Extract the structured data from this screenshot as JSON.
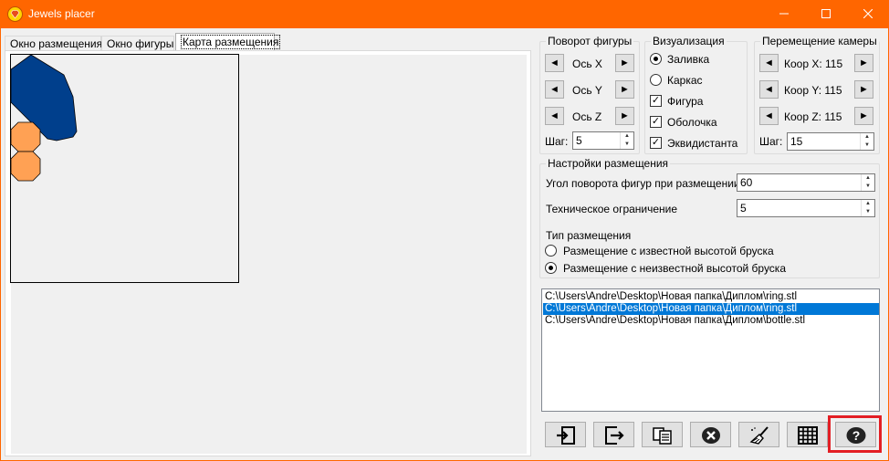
{
  "window": {
    "title": "Jewels placer",
    "accent": "#ff6600",
    "controls": {
      "minimize": "minimize-icon",
      "maximize": "maximize-icon",
      "close": "close-icon"
    }
  },
  "tabs": [
    {
      "label": "Окно размещения"
    },
    {
      "label": "Окно фигуры"
    },
    {
      "label": "Карта размещения",
      "active": true
    }
  ],
  "rotation": {
    "title": "Поворот фигуры",
    "axes": [
      "Ось X",
      "Ось Y",
      "Ось Z"
    ],
    "step_label": "Шаг:",
    "step_value": "5"
  },
  "visualization": {
    "title": "Визуализация",
    "radios": [
      {
        "label": "Заливка",
        "checked": true
      },
      {
        "label": "Каркас",
        "checked": false
      }
    ],
    "checks": [
      {
        "label": "Фигура",
        "checked": true
      },
      {
        "label": "Оболочка",
        "checked": true
      },
      {
        "label": "Эквидистанта",
        "checked": true
      }
    ],
    "check_mark": "✓"
  },
  "camera": {
    "title": "Перемещение камеры",
    "coords": [
      "Коор X: 115",
      "Коор Y: 115",
      "Коор Z: 115"
    ],
    "step_label": "Шаг:",
    "step_value": "15"
  },
  "placement": {
    "title": "Настройки размещения",
    "angle_label": "Угол поворота фигур при размещении",
    "angle_value": "60",
    "limit_label": "Техническое ограничение",
    "limit_value": "5",
    "type_label": "Тип размещения",
    "options": [
      {
        "label": "Размещение с известной высотой бруска",
        "checked": false
      },
      {
        "label": "Размещение с неизвестной высотой бруска",
        "checked": true
      }
    ]
  },
  "files": [
    {
      "path": "C:\\Users\\Andre\\Desktop\\Новая папка\\Диплом\\ring.stl",
      "selected": false
    },
    {
      "path": "C:\\Users\\Andre\\Desktop\\Новая папка\\Диплом\\ring.stl",
      "selected": true
    },
    {
      "path": "C:\\Users\\Andre\\Desktop\\Новая папка\\Диплом\\bottle.stl",
      "selected": false
    }
  ],
  "toolbar": [
    "import-icon",
    "export-icon",
    "copy-icon",
    "delete-icon",
    "clear-icon",
    "grid-icon",
    "help-icon"
  ],
  "toolbar_help_glyph": "?",
  "map": {
    "shapes": [
      {
        "kind": "blue-polygon",
        "color": "#003f8c"
      },
      {
        "kind": "orange-octagon",
        "color": "#ffa154"
      },
      {
        "kind": "orange-octagon",
        "color": "#ffa154"
      }
    ]
  }
}
